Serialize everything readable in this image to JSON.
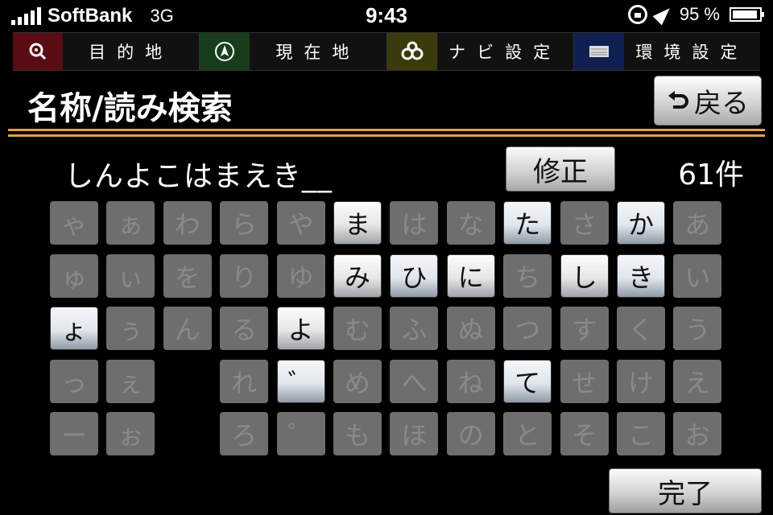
{
  "status_bar": {
    "carrier": "SoftBank",
    "network": "3G",
    "time": "9:43",
    "battery": "95 %",
    "battery_level": 0.95
  },
  "menu": [
    {
      "label": "目的地",
      "icon": "destination-search-icon"
    },
    {
      "label": "現在地",
      "icon": "current-location-icon"
    },
    {
      "label": "ナビ設定",
      "icon": "navi-settings-icon"
    },
    {
      "label": "環境設定",
      "icon": "environment-settings-icon"
    }
  ],
  "page": {
    "title": "名称/読み検索",
    "back_label": "戻る"
  },
  "search": {
    "query": "しんよこはまえき__",
    "fix_label": "修正",
    "count": "61件"
  },
  "keyboard": {
    "rows": [
      [
        {
          "c": "ゃ",
          "on": false
        },
        {
          "c": "ぁ",
          "on": false
        },
        {
          "c": "わ",
          "on": false
        },
        {
          "c": "ら",
          "on": false
        },
        {
          "c": "や",
          "on": false
        },
        {
          "c": "ま",
          "on": true
        },
        {
          "c": "は",
          "on": false
        },
        {
          "c": "な",
          "on": false
        },
        {
          "c": "た",
          "on": true
        },
        {
          "c": "さ",
          "on": false
        },
        {
          "c": "か",
          "on": true
        },
        {
          "c": "あ",
          "on": false
        }
      ],
      [
        {
          "c": "ゅ",
          "on": false
        },
        {
          "c": "ぃ",
          "on": false
        },
        {
          "c": "を",
          "on": false
        },
        {
          "c": "り",
          "on": false
        },
        {
          "c": "ゆ",
          "on": false
        },
        {
          "c": "み",
          "on": true
        },
        {
          "c": "ひ",
          "on": true
        },
        {
          "c": "に",
          "on": true
        },
        {
          "c": "ち",
          "on": false
        },
        {
          "c": "し",
          "on": true
        },
        {
          "c": "き",
          "on": true
        },
        {
          "c": "い",
          "on": false
        }
      ],
      [
        {
          "c": "ょ",
          "on": true
        },
        {
          "c": "ぅ",
          "on": false
        },
        {
          "c": "ん",
          "on": false
        },
        {
          "c": "る",
          "on": false
        },
        {
          "c": "よ",
          "on": true
        },
        {
          "c": "む",
          "on": false
        },
        {
          "c": "ふ",
          "on": false
        },
        {
          "c": "ぬ",
          "on": false
        },
        {
          "c": "つ",
          "on": false
        },
        {
          "c": "す",
          "on": false
        },
        {
          "c": "く",
          "on": false
        },
        {
          "c": "う",
          "on": false
        }
      ],
      [
        {
          "c": "っ",
          "on": false
        },
        {
          "c": "ぇ",
          "on": false
        },
        null,
        {
          "c": "れ",
          "on": false
        },
        {
          "c": "゛",
          "on": true
        },
        {
          "c": "め",
          "on": false
        },
        {
          "c": "へ",
          "on": false
        },
        {
          "c": "ね",
          "on": false
        },
        {
          "c": "て",
          "on": true
        },
        {
          "c": "せ",
          "on": false
        },
        {
          "c": "け",
          "on": false
        },
        {
          "c": "え",
          "on": false
        }
      ],
      [
        {
          "c": "ー",
          "on": false
        },
        {
          "c": "ぉ",
          "on": false
        },
        null,
        {
          "c": "ろ",
          "on": false
        },
        {
          "c": "゜",
          "on": false
        },
        {
          "c": "も",
          "on": false
        },
        {
          "c": "ほ",
          "on": false
        },
        {
          "c": "の",
          "on": false
        },
        {
          "c": "と",
          "on": false
        },
        {
          "c": "そ",
          "on": false
        },
        {
          "c": "こ",
          "on": false
        },
        {
          "c": "お",
          "on": false
        }
      ]
    ]
  },
  "done_label": "完了",
  "colors": {
    "accent_orange": "#e3a13a",
    "key_disabled": "#6e6e6e",
    "menu_dest": "#5a0b14",
    "menu_current": "#173d1d",
    "menu_navi": "#3b3a0c",
    "menu_env": "#101f52"
  }
}
